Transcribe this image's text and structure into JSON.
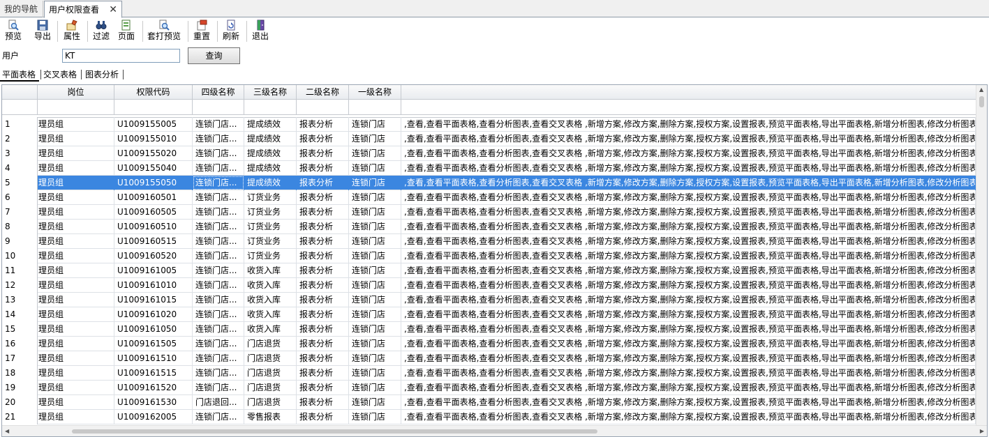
{
  "tabs": {
    "nav": "我的导航",
    "active": "用户权限查看",
    "close_glyph": "✕"
  },
  "toolbar": [
    {
      "label": "预览",
      "icon": "magnifier-icon"
    },
    {
      "label": "导出",
      "icon": "floppy-disk-icon"
    },
    {
      "label": "属性",
      "icon": "properties-icon"
    },
    {
      "label": "过滤",
      "icon": "binoculars-icon"
    },
    {
      "label": "页面",
      "icon": "page-setup-icon"
    },
    {
      "label": "套打预览",
      "icon": "print-preview-icon"
    },
    {
      "label": "重置",
      "icon": "reset-icon"
    },
    {
      "label": "刷新",
      "icon": "refresh-icon"
    },
    {
      "label": "退出",
      "icon": "exit-door-icon"
    }
  ],
  "query": {
    "label": "用户",
    "value": "KT",
    "button": "查询"
  },
  "view_tabs": [
    "平面表格",
    "交叉表格",
    "图表分析"
  ],
  "grid": {
    "columns": [
      "岗位",
      "权限代码",
      "四级名称",
      "三级名称",
      "二级名称",
      "一级名称"
    ],
    "selected_row": 5,
    "rows": [
      {
        "no": "1",
        "role": "理员组",
        "code": "U1009155005",
        "l4": "连锁门店...",
        "l3": "提成绩效",
        "l2": "报表分析",
        "l1": "连锁门店",
        "perms": ",查看,查看平面表格,查看分析图表,查看交叉表格 ,新增方案,修改方案,删除方案,授权方案,设置报表,预览平面表格,导出平面表格,新增分析图表,修改分析图表"
      },
      {
        "no": "2",
        "role": "理员组",
        "code": "U1009155010",
        "l4": "连锁门店...",
        "l3": "提成绩效",
        "l2": "报表分析",
        "l1": "连锁门店",
        "perms": ",查看,查看平面表格,查看分析图表,查看交叉表格 ,新增方案,修改方案,删除方案,授权方案,设置报表,预览平面表格,导出平面表格,新增分析图表,修改分析图表"
      },
      {
        "no": "3",
        "role": "理员组",
        "code": "U1009155020",
        "l4": "连锁门店...",
        "l3": "提成绩效",
        "l2": "报表分析",
        "l1": "连锁门店",
        "perms": ",查看,查看平面表格,查看分析图表,查看交叉表格 ,新增方案,修改方案,删除方案,授权方案,设置报表,预览平面表格,导出平面表格,新增分析图表,修改分析图表"
      },
      {
        "no": "4",
        "role": "理员组",
        "code": "U1009155040",
        "l4": "连锁门店...",
        "l3": "提成绩效",
        "l2": "报表分析",
        "l1": "连锁门店",
        "perms": ",查看,查看平面表格,查看分析图表,查看交叉表格 ,新增方案,修改方案,删除方案,授权方案,设置报表,预览平面表格,导出平面表格,新增分析图表,修改分析图表"
      },
      {
        "no": "5",
        "role": "理员组",
        "code": "U1009155050",
        "l4": "连锁门店...",
        "l3": "提成绩效",
        "l2": "报表分析",
        "l1": "连锁门店",
        "perms": ",查看,查看平面表格,查看分析图表,查看交叉表格 ,新增方案,修改方案,删除方案,授权方案,设置报表,预览平面表格,导出平面表格,新增分析图表,修改分析图表"
      },
      {
        "no": "6",
        "role": "理员组",
        "code": "U1009160501",
        "l4": "连锁门店...",
        "l3": "订货业务",
        "l2": "报表分析",
        "l1": "连锁门店",
        "perms": ",查看,查看平面表格,查看分析图表,查看交叉表格 ,新增方案,修改方案,删除方案,授权方案,设置报表,预览平面表格,导出平面表格,新增分析图表,修改分析图表"
      },
      {
        "no": "7",
        "role": "理员组",
        "code": "U1009160505",
        "l4": "连锁门店...",
        "l3": "订货业务",
        "l2": "报表分析",
        "l1": "连锁门店",
        "perms": ",查看,查看平面表格,查看分析图表,查看交叉表格 ,新增方案,修改方案,删除方案,授权方案,设置报表,预览平面表格,导出平面表格,新增分析图表,修改分析图表"
      },
      {
        "no": "8",
        "role": "理员组",
        "code": "U1009160510",
        "l4": "连锁门店...",
        "l3": "订货业务",
        "l2": "报表分析",
        "l1": "连锁门店",
        "perms": ",查看,查看平面表格,查看分析图表,查看交叉表格 ,新增方案,修改方案,删除方案,授权方案,设置报表,预览平面表格,导出平面表格,新增分析图表,修改分析图表"
      },
      {
        "no": "9",
        "role": "理员组",
        "code": "U1009160515",
        "l4": "连锁门店...",
        "l3": "订货业务",
        "l2": "报表分析",
        "l1": "连锁门店",
        "perms": ",查看,查看平面表格,查看分析图表,查看交叉表格 ,新增方案,修改方案,删除方案,授权方案,设置报表,预览平面表格,导出平面表格,新增分析图表,修改分析图表"
      },
      {
        "no": "10",
        "role": "理员组",
        "code": "U1009160520",
        "l4": "连锁门店...",
        "l3": "订货业务",
        "l2": "报表分析",
        "l1": "连锁门店",
        "perms": ",查看,查看平面表格,查看分析图表,查看交叉表格 ,新增方案,修改方案,删除方案,授权方案,设置报表,预览平面表格,导出平面表格,新增分析图表,修改分析图表"
      },
      {
        "no": "11",
        "role": "理员组",
        "code": "U1009161005",
        "l4": "连锁门店...",
        "l3": "收货入库",
        "l2": "报表分析",
        "l1": "连锁门店",
        "perms": ",查看,查看平面表格,查看分析图表,查看交叉表格 ,新增方案,修改方案,删除方案,授权方案,设置报表,预览平面表格,导出平面表格,新增分析图表,修改分析图表"
      },
      {
        "no": "12",
        "role": "理员组",
        "code": "U1009161010",
        "l4": "连锁门店...",
        "l3": "收货入库",
        "l2": "报表分析",
        "l1": "连锁门店",
        "perms": ",查看,查看平面表格,查看分析图表,查看交叉表格 ,新增方案,修改方案,删除方案,授权方案,设置报表,预览平面表格,导出平面表格,新增分析图表,修改分析图表"
      },
      {
        "no": "13",
        "role": "理员组",
        "code": "U1009161015",
        "l4": "连锁门店...",
        "l3": "收货入库",
        "l2": "报表分析",
        "l1": "连锁门店",
        "perms": ",查看,查看平面表格,查看分析图表,查看交叉表格 ,新增方案,修改方案,删除方案,授权方案,设置报表,预览平面表格,导出平面表格,新增分析图表,修改分析图表"
      },
      {
        "no": "14",
        "role": "理员组",
        "code": "U1009161020",
        "l4": "连锁门店...",
        "l3": "收货入库",
        "l2": "报表分析",
        "l1": "连锁门店",
        "perms": ",查看,查看平面表格,查看分析图表,查看交叉表格 ,新增方案,修改方案,删除方案,授权方案,设置报表,预览平面表格,导出平面表格,新增分析图表,修改分析图表"
      },
      {
        "no": "15",
        "role": "理员组",
        "code": "U1009161050",
        "l4": "连锁门店...",
        "l3": "收货入库",
        "l2": "报表分析",
        "l1": "连锁门店",
        "perms": ",查看,查看平面表格,查看分析图表,查看交叉表格 ,新增方案,修改方案,删除方案,授权方案,设置报表,预览平面表格,导出平面表格,新增分析图表,修改分析图表"
      },
      {
        "no": "16",
        "role": "理员组",
        "code": "U1009161505",
        "l4": "连锁门店...",
        "l3": "门店退货",
        "l2": "报表分析",
        "l1": "连锁门店",
        "perms": ",查看,查看平面表格,查看分析图表,查看交叉表格 ,新增方案,修改方案,删除方案,授权方案,设置报表,预览平面表格,导出平面表格,新增分析图表,修改分析图表"
      },
      {
        "no": "17",
        "role": "理员组",
        "code": "U1009161510",
        "l4": "连锁门店...",
        "l3": "门店退货",
        "l2": "报表分析",
        "l1": "连锁门店",
        "perms": ",查看,查看平面表格,查看分析图表,查看交叉表格 ,新增方案,修改方案,删除方案,授权方案,设置报表,预览平面表格,导出平面表格,新增分析图表,修改分析图表"
      },
      {
        "no": "18",
        "role": "理员组",
        "code": "U1009161515",
        "l4": "连锁门店...",
        "l3": "门店退货",
        "l2": "报表分析",
        "l1": "连锁门店",
        "perms": ",查看,查看平面表格,查看分析图表,查看交叉表格 ,新增方案,修改方案,删除方案,授权方案,设置报表,预览平面表格,导出平面表格,新增分析图表,修改分析图表"
      },
      {
        "no": "19",
        "role": "理员组",
        "code": "U1009161520",
        "l4": "连锁门店...",
        "l3": "门店退货",
        "l2": "报表分析",
        "l1": "连锁门店",
        "perms": ",查看,查看平面表格,查看分析图表,查看交叉表格 ,新增方案,修改方案,删除方案,授权方案,设置报表,预览平面表格,导出平面表格,新增分析图表,修改分析图表"
      },
      {
        "no": "20",
        "role": "理员组",
        "code": "U1009161530",
        "l4": "门店退回...",
        "l3": "门店退货",
        "l2": "报表分析",
        "l1": "连锁门店",
        "perms": ",查看,查看平面表格,查看分析图表,查看交叉表格 ,新增方案,修改方案,删除方案,授权方案,设置报表,预览平面表格,导出平面表格,新增分析图表,修改分析图表"
      },
      {
        "no": "21",
        "role": "理员组",
        "code": "U1009162005",
        "l4": "连锁门店...",
        "l3": "零售报表",
        "l2": "报表分析",
        "l1": "连锁门店",
        "perms": ",查看,查看平面表格,查看分析图表,查看交叉表格 ,新增方案,修改方案,删除方案,授权方案,设置报表,预览平面表格,导出平面表格,新增分析图表,修改分析图表"
      }
    ]
  },
  "colors": {
    "selection": "#3b86e0",
    "grid_border": "#c5c9cf"
  }
}
